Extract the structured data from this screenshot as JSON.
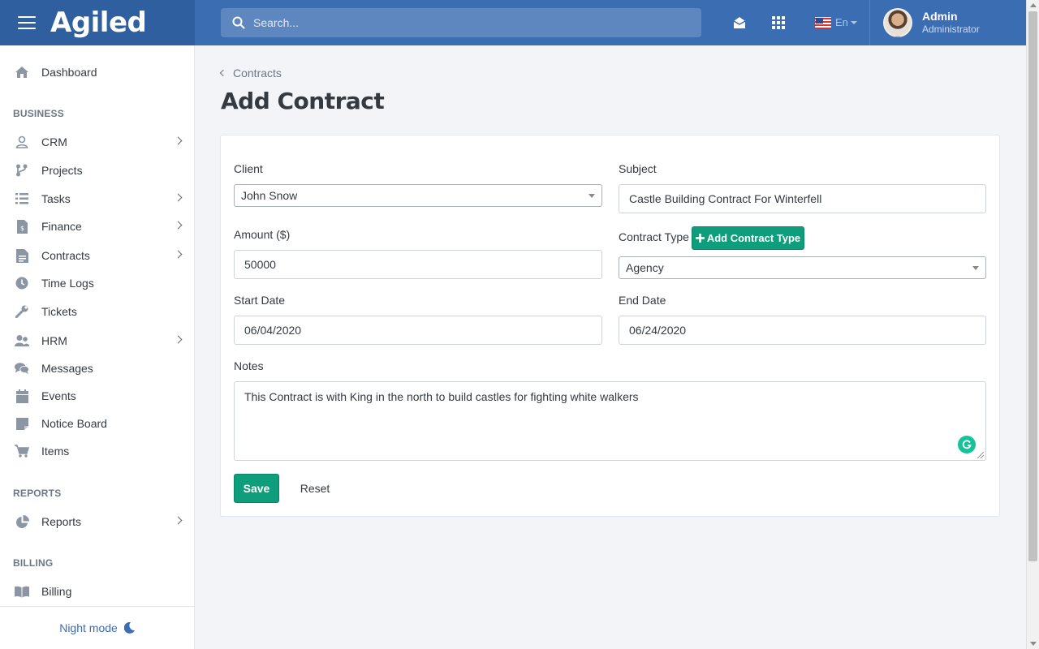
{
  "header": {
    "logo": "Agiled",
    "search_placeholder": "Search...",
    "language": "En",
    "user_name": "Admin",
    "user_role": "Administrator"
  },
  "sidebar": {
    "dashboard": "Dashboard",
    "business_section": "BUSINESS",
    "items": [
      {
        "label": "CRM",
        "icon": "user-icon",
        "has_submenu": true
      },
      {
        "label": "Projects",
        "icon": "projects-icon",
        "has_submenu": false
      },
      {
        "label": "Tasks",
        "icon": "list-icon",
        "has_submenu": true
      },
      {
        "label": "Finance",
        "icon": "invoice-icon",
        "has_submenu": true
      },
      {
        "label": "Contracts",
        "icon": "contract-icon",
        "has_submenu": true
      },
      {
        "label": "Time Logs",
        "icon": "clock-icon",
        "has_submenu": false
      },
      {
        "label": "Tickets",
        "icon": "wrench-icon",
        "has_submenu": false
      },
      {
        "label": "HRM",
        "icon": "users-icon",
        "has_submenu": true
      },
      {
        "label": "Messages",
        "icon": "chat-icon",
        "has_submenu": false
      },
      {
        "label": "Events",
        "icon": "calendar-icon",
        "has_submenu": false
      },
      {
        "label": "Notice Board",
        "icon": "sticky-note-icon",
        "has_submenu": false
      },
      {
        "label": "Items",
        "icon": "cart-icon",
        "has_submenu": false
      }
    ],
    "reports_section": "REPORTS",
    "reports": "Reports",
    "billing_section": "BILLING",
    "billing": "Billing",
    "night_mode": "Night mode"
  },
  "breadcrumb": "Contracts",
  "page_title": "Add Contract",
  "form": {
    "client_label": "Client",
    "client_value": "John Snow",
    "subject_label": "Subject",
    "subject_value": "Castle Building Contract For Winterfell",
    "amount_label": "Amount ($)",
    "amount_value": "50000",
    "contract_type_label": "Contract Type",
    "add_contract_type": "Add Contract Type",
    "contract_type_value": "Agency",
    "start_date_label": "Start Date",
    "start_date_value": "06/04/2020",
    "end_date_label": "End Date",
    "end_date_value": "06/24/2020",
    "notes_label": "Notes",
    "notes_value": "This Contract is with King in the north to build castles for fighting white walkers",
    "save": "Save",
    "reset": "Reset"
  },
  "colors": {
    "header": "#3b6db3",
    "brand_bg": "#2f5f9e",
    "primary_button": "#0f9e7b",
    "sidebar_icon": "#8c95a3"
  }
}
